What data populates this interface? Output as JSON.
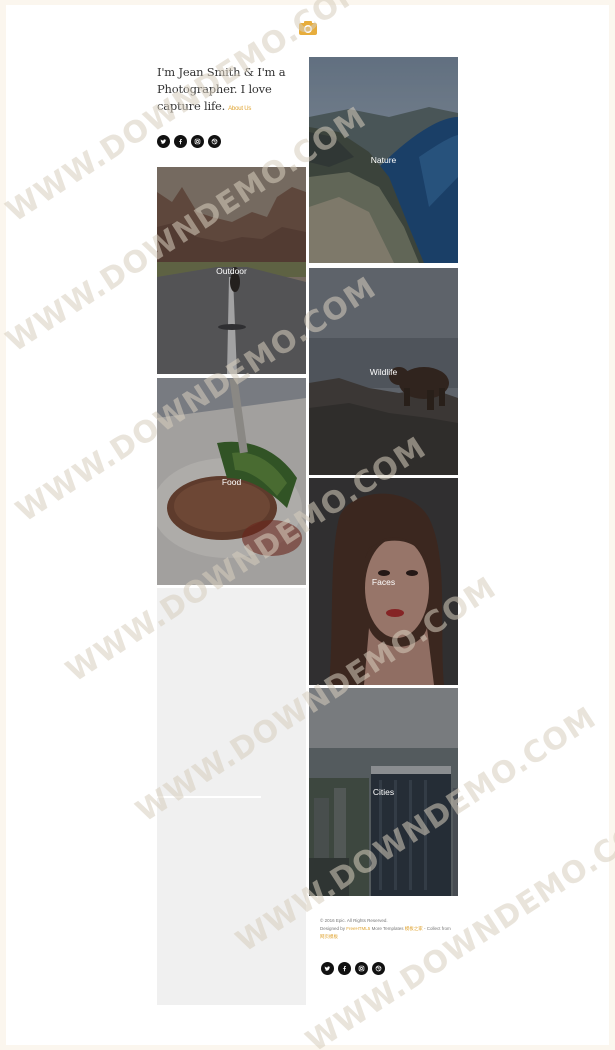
{
  "intro": {
    "text": "I'm Jean Smith & I'm a Photographer. I love capture life.",
    "link_label": "About Us"
  },
  "tiles": [
    {
      "label": "Nature"
    },
    {
      "label": "Outdoor"
    },
    {
      "label": "Wildlife"
    },
    {
      "label": "Food"
    },
    {
      "label": "Faces"
    },
    {
      "label": "Cities"
    }
  ],
  "footer": {
    "copyright": "© 2016 Epic. All Rights Reserved.",
    "designed_prefix": "Designed by",
    "designer": "FreeHTML5",
    "designed_mid": "More Templates",
    "more_link": "模板之家",
    "collect_from": "- Collect from",
    "collect_link": "网页模板"
  },
  "socials": [
    "twitter-icon",
    "facebook-icon",
    "instagram-icon",
    "dribbble-icon"
  ],
  "watermark": "WWW.DOWNDEMO.COM",
  "colors": {
    "accent": "#e0a431",
    "background": "#fbf6ee"
  }
}
